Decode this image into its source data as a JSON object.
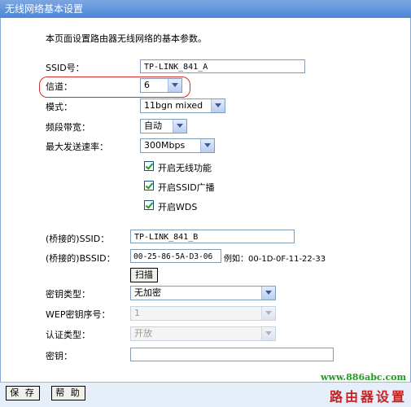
{
  "window": {
    "title": "无线网络基本设置"
  },
  "intro": "本页面设置路由器无线网络的基本参数。",
  "fields": {
    "ssid": {
      "label": "SSID号：",
      "value": "TP-LINK_841_A"
    },
    "channel": {
      "label": "信道：",
      "value": "6"
    },
    "mode": {
      "label": "模式：",
      "value": "11bgn mixed"
    },
    "bandwidth": {
      "label": "频段带宽：",
      "value": "自动"
    },
    "max_rate": {
      "label": "最大发送速率：",
      "value": "300Mbps"
    }
  },
  "checkboxes": [
    {
      "label": "开启无线功能",
      "checked": true
    },
    {
      "label": "开启SSID广播",
      "checked": true
    },
    {
      "label": "开启WDS",
      "checked": true
    }
  ],
  "wds": {
    "bridged_ssid": {
      "label": "(桥接的)SSID：",
      "value": "TP-LINK_841_B"
    },
    "bridged_bssid": {
      "label": "(桥接的)BSSID：",
      "value": "00-25-86-5A-D3-06",
      "example": "例如：00-1D-0F-11-22-33"
    },
    "scan_button": "扫描",
    "key_type": {
      "label": "密钥类型：",
      "value": "无加密"
    },
    "wep_index": {
      "label": "WEP密钥序号：",
      "value": "1"
    },
    "auth_type": {
      "label": "认证类型：",
      "value": "开放"
    },
    "key": {
      "label": "密钥：",
      "value": ""
    }
  },
  "buttons": {
    "save": "保 存",
    "help": "帮 助"
  },
  "watermark": {
    "url": "www.886abc.com",
    "text": "路由器设置"
  },
  "colors": {
    "title_bar": "#4d86d8",
    "highlight": "#d62a2a",
    "watermark_url": "#1f9c1f",
    "watermark_text": "#c72020"
  }
}
